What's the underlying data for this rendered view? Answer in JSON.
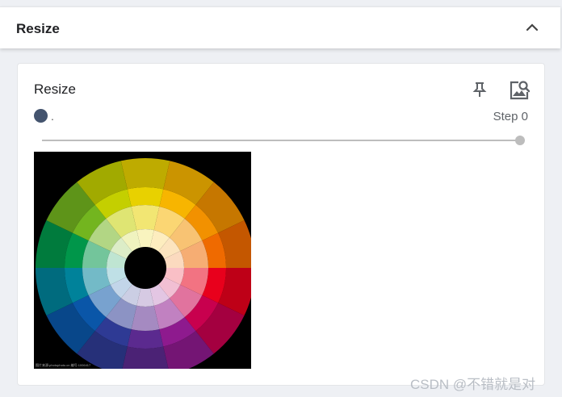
{
  "header": {
    "title": "Resize"
  },
  "card": {
    "title": "Resize",
    "run_label": ".",
    "step_label": "Step 0",
    "slider": {
      "value": 1.0
    },
    "image": {
      "caption": "图片来源:photophoto.cn  编号:1006417"
    }
  },
  "watermark": "CSDN @不错就是对",
  "colors": {
    "run_dot": "#44546e",
    "slider": "#bdbdbd",
    "wheel": [
      "#e8d100",
      "#f7b500",
      "#f29100",
      "#ef6a00",
      "#e8001c",
      "#c8004e",
      "#8e1a8e",
      "#5b2a8f",
      "#2e3a94",
      "#0a56a8",
      "#00829a",
      "#00964a",
      "#73b51f",
      "#c4cf00"
    ]
  }
}
